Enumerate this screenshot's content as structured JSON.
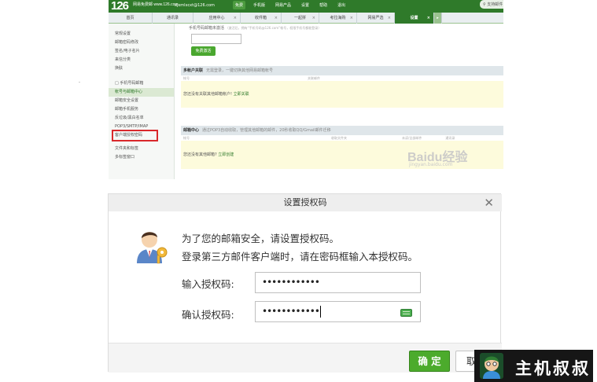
{
  "mail": {
    "logo": "126",
    "logo_sub": "网易免费邮 www.126.com",
    "account": "xjxmlxcxt@126.com",
    "header_links": [
      "免费",
      "手机版",
      "网易产品",
      "设置",
      "帮助",
      "退出"
    ],
    "search_placeholder": "支持邮件",
    "tabs": [
      {
        "label": "首页",
        "active": false
      },
      {
        "label": "通讯录",
        "active": false
      },
      {
        "label": "应用中心",
        "active": false
      },
      {
        "label": "收件箱",
        "active": false
      },
      {
        "label": "一起拼",
        "active": false
      },
      {
        "label": "考拉海购",
        "active": false
      },
      {
        "label": "网易严选",
        "active": false
      },
      {
        "label": "设置",
        "active": true
      }
    ],
    "sidebar": [
      {
        "label": "常规设置",
        "state": "normal"
      },
      {
        "label": "邮箱密码修改",
        "state": "normal"
      },
      {
        "label": "签名/电子名片",
        "state": "normal"
      },
      {
        "label": "来信分类",
        "state": "normal"
      },
      {
        "label": "换肤",
        "state": "normal"
      },
      {
        "label": "",
        "state": "spacer"
      },
      {
        "label": "□ 手机号码邮箱",
        "state": "normal"
      },
      {
        "label": "帐号与邮箱中心",
        "state": "current"
      },
      {
        "label": "邮箱安全设置",
        "state": "normal"
      },
      {
        "label": "邮箱手机服务",
        "state": "normal"
      },
      {
        "label": "反垃圾/黑白名单",
        "state": "normal"
      },
      {
        "label": "POP3/SMTP/IMAP",
        "state": "normal"
      },
      {
        "label": "客户端授权密码",
        "state": "highlight"
      },
      {
        "label": "",
        "state": "spacer"
      },
      {
        "label": "文件夹和标签",
        "state": "normal"
      },
      {
        "label": "多标签窗口",
        "state": "normal"
      }
    ],
    "phone_section_title": "手机号码邮箱未激活",
    "phone_section_note": "（激活后，拥有“手机号码@126.com”帐号，权限手机号都能登录）",
    "activate_button": "免费激活",
    "multi_account": {
      "title": "多帐户关联",
      "note": "无需登录，一键切换其他网易邮箱帐号",
      "cols": [
        "帐号",
        "关联邮件"
      ],
      "body_text": "您还没有关联其他邮箱帐户!",
      "link": "立即关联"
    },
    "mail_center": {
      "title": "邮箱中心",
      "note": "通过POP3自动收取，管理其他邮箱的邮件，20秒收取QQ/Gmail邮件迁移",
      "cols": [
        "帐号",
        "收取文件夹",
        "未读/全部邮件",
        "通讯录"
      ],
      "body_text": "您还没有其他邮箱?",
      "link": "立即创建"
    },
    "watermark": "Baidu经验",
    "watermark_sub": "jingyan.baidu.com"
  },
  "dialog": {
    "title": "设置授权码",
    "close": "✕",
    "message_line1": "为了您的邮箱安全，请设置授权码。",
    "message_line2": "登录第三方邮件客户端时，请在密码框输入本授权码。",
    "field1_label": "输入授权码:",
    "field1_value": "••••••••••••",
    "field2_label": "确认授权码:",
    "field2_value": "••••••••••••",
    "ok_button": "确 定",
    "cancel_button": "取消"
  },
  "badge": {
    "text": "主机叔叔",
    "icon": "mascot-icon"
  },
  "colors": {
    "brand_green": "#2f7a2a",
    "ok_green": "#4cab2c",
    "highlight_red": "#d9282b"
  }
}
